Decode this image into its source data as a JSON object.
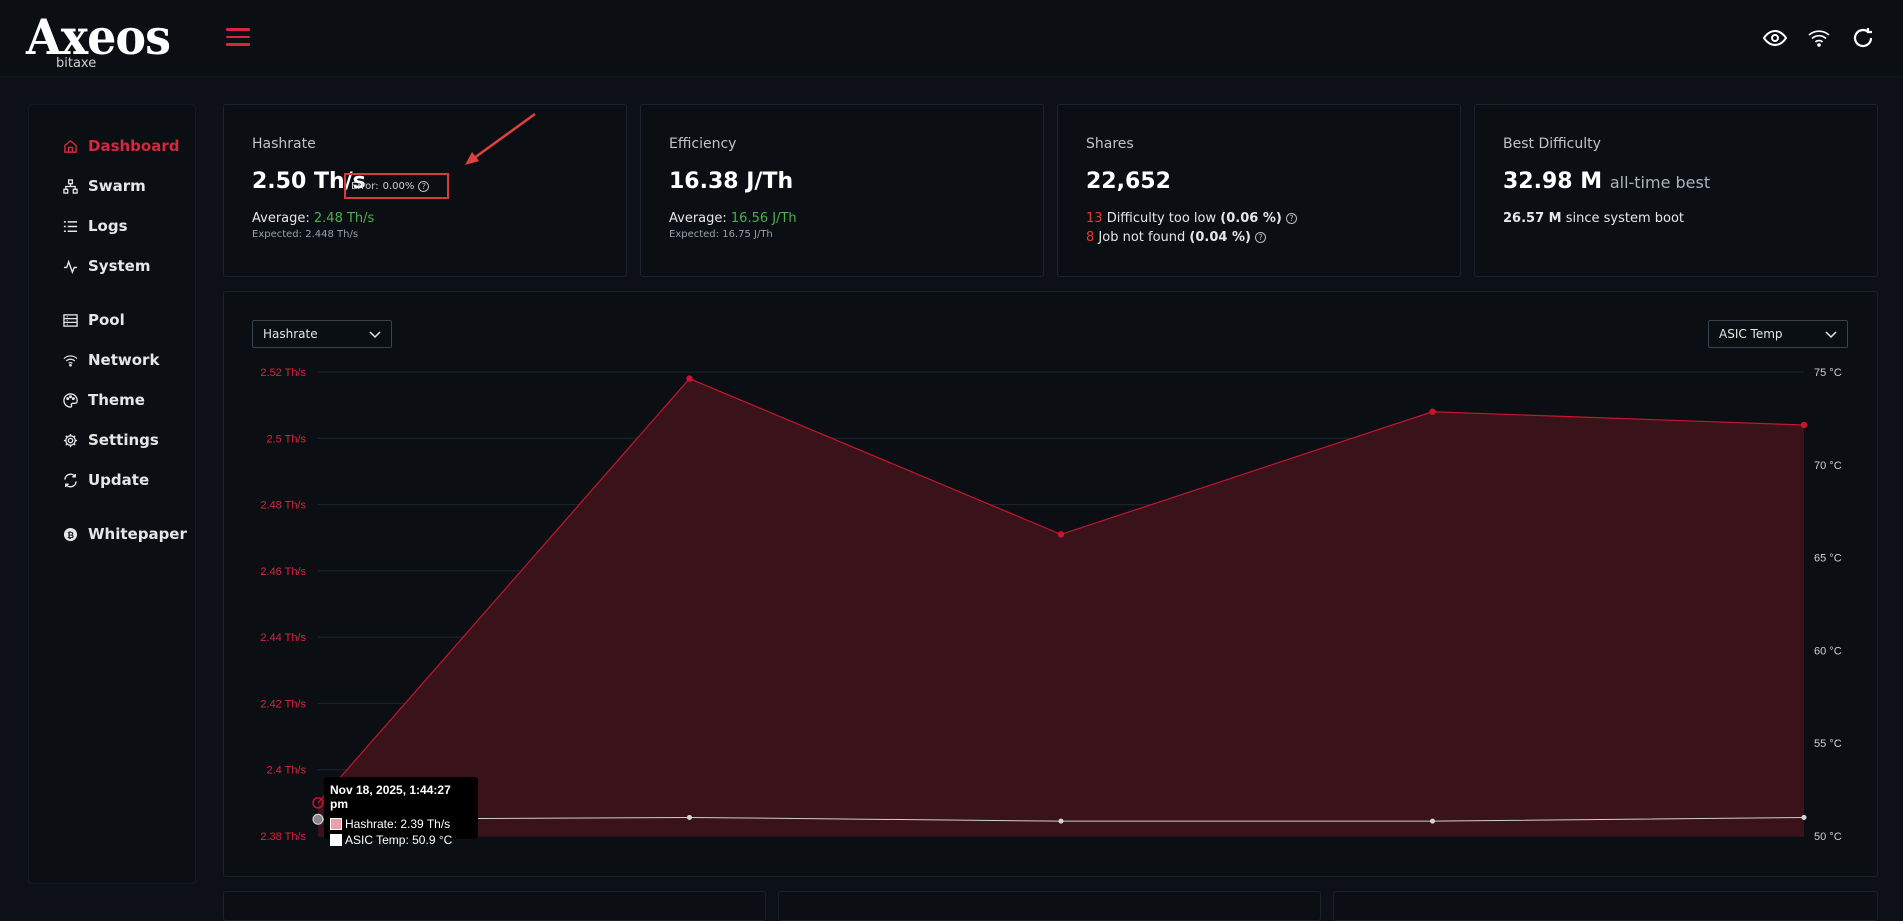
{
  "header": {
    "logo_text": "Axeos",
    "logo_sub": "bitaxe",
    "icons": [
      "eye-icon",
      "wifi-icon",
      "refresh-icon"
    ]
  },
  "sidebar": {
    "items": [
      {
        "label": "Dashboard",
        "icon": "home-icon",
        "active": true
      },
      {
        "label": "Swarm",
        "icon": "sitemap-icon"
      },
      {
        "label": "Logs",
        "icon": "list-icon"
      },
      {
        "label": "System",
        "icon": "pulse-icon"
      },
      {
        "label": "Pool",
        "icon": "server-icon"
      },
      {
        "label": "Network",
        "icon": "wifi-icon"
      },
      {
        "label": "Theme",
        "icon": "palette-icon"
      },
      {
        "label": "Settings",
        "icon": "gear-icon"
      },
      {
        "label": "Update",
        "icon": "sync-icon"
      },
      {
        "label": "Whitepaper",
        "icon": "bitcoin-icon"
      }
    ]
  },
  "cards": {
    "hashrate": {
      "title": "Hashrate",
      "value": "2.50 Th/s",
      "error_label": "Error:",
      "error_value": "0.00%",
      "average_label": "Average:",
      "average_value": "2.48 Th/s",
      "expected": "Expected: 2.448 Th/s"
    },
    "efficiency": {
      "title": "Efficiency",
      "value": "16.38 J/Th",
      "average_label": "Average:",
      "average_value": "16.56 J/Th",
      "expected": "Expected: 16.75 J/Th"
    },
    "shares": {
      "title": "Shares",
      "value": "22,652",
      "rej1_count": "13",
      "rej1_label": "Difficulty too low",
      "rej1_pct": "(0.06 %)",
      "rej2_count": "8",
      "rej2_label": "Job not found",
      "rej2_pct": "(0.04 %)"
    },
    "best_difficulty": {
      "title": "Best Difficulty",
      "value": "32.98 M",
      "value_suffix": "all-time best",
      "since_value": "26.57 M",
      "since_label": "since system boot"
    }
  },
  "chart": {
    "left_select": "Hashrate",
    "right_select": "ASIC Temp",
    "tooltip_title": "Nov 18, 2025, 1:44:27 pm",
    "tooltip_hashrate": "Hashrate: 2.39 Th/s",
    "tooltip_temp": "ASIC Temp: 50.9 °C"
  },
  "colors": {
    "accent": "#d7263d",
    "positive": "#4caf50",
    "background": "#0d1117",
    "card": "#0b0f14"
  },
  "chart_data": {
    "type": "line",
    "series": [
      {
        "name": "Hashrate",
        "values": [
          2.39,
          2.518,
          2.471,
          2.508,
          2.504
        ]
      },
      {
        "name": "ASIC Temp",
        "values": [
          50.9,
          51.0,
          50.8,
          50.8,
          51.0
        ]
      }
    ],
    "y_ticks_left": [
      "2.52 Th/s",
      "2.5 Th/s",
      "2.48 Th/s",
      "2.46 Th/s",
      "2.44 Th/s",
      "2.42 Th/s",
      "2.4 Th/s",
      "2.38 Th/s"
    ],
    "y_ticks_right": [
      "75 °C",
      "70 °C",
      "65 °C",
      "60 °C",
      "55 °C",
      "50 °C"
    ],
    "ylim_left": [
      2.38,
      2.52
    ],
    "ylim_right": [
      50,
      75
    ],
    "grid": true
  }
}
